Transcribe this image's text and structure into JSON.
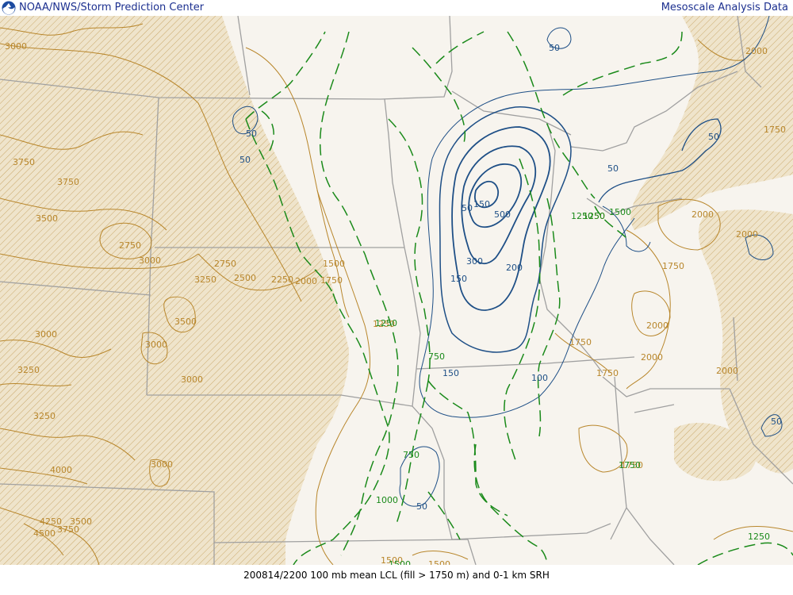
{
  "header": {
    "left_title": "NOAA/NWS/Storm Prediction Center",
    "right_title": "Mesoscale Analysis Data"
  },
  "footer": {
    "caption": "200814/2200 100 mb mean LCL (fill > 1750 m) and 0-1 km SRH"
  },
  "colors": {
    "lcl_contour": "#b8862b",
    "lcl_fill": "#efe4cb",
    "lcl_hatch": "#c9a86a",
    "srh_contour": "#1e4f86",
    "dashed_contour": "#1a8a1a",
    "borders": "#a0a0a0",
    "background": "#f7f4ee",
    "header_text": "#1b2f8f"
  },
  "icons": {
    "logo": "noaa-logo-icon"
  },
  "lcl_labels": [
    "3000",
    "3750",
    "3750",
    "3500",
    "2750",
    "3000",
    "3250",
    "2500",
    "2250",
    "2000",
    "1750",
    "1500",
    "2750",
    "3500",
    "3000",
    "3000",
    "3000",
    "3250",
    "3250",
    "3000",
    "4000",
    "4250",
    "3750",
    "3500",
    "4500",
    "1500",
    "1500",
    "1250",
    "1750",
    "2000",
    "2000",
    "1750",
    "1750",
    "2000",
    "2000",
    "2000",
    "1750",
    "1250",
    "2000",
    "1750"
  ],
  "srh_labels": [
    "50",
    "50",
    "50",
    "50",
    "500",
    "300",
    "200",
    "150",
    "150",
    "100",
    "50",
    "50",
    "150",
    "50",
    "50"
  ],
  "dashed_labels": [
    "1250",
    "750",
    "750",
    "1000",
    "1500",
    "1250",
    "1250",
    "1500",
    "1750",
    "1250"
  ]
}
